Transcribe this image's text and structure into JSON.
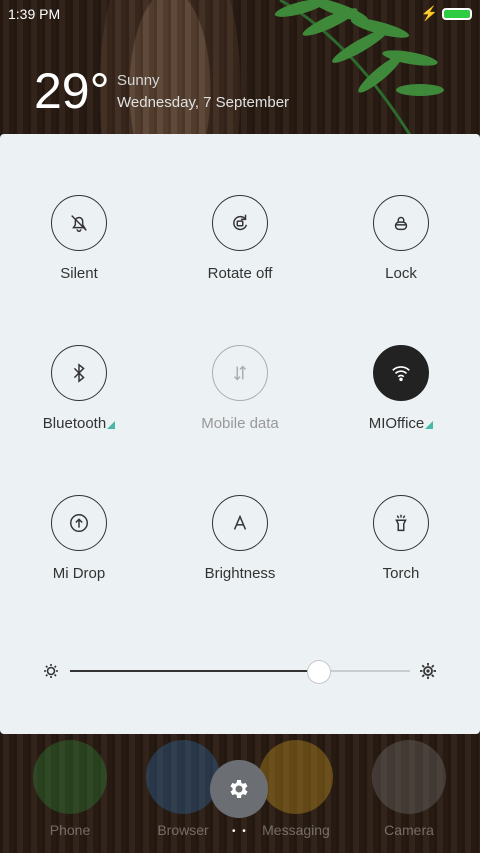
{
  "status_bar": {
    "time": "1:39 PM"
  },
  "weather": {
    "temperature": "29°",
    "condition": "Sunny",
    "date": "Wednesday, 7 September"
  },
  "quick_settings": [
    {
      "label": "Silent",
      "icon": "bell-off-icon",
      "state": "off"
    },
    {
      "label": "Rotate off",
      "icon": "rotate-lock-icon",
      "state": "off"
    },
    {
      "label": "Lock",
      "icon": "lock-icon",
      "state": "off"
    },
    {
      "label": "Bluetooth",
      "icon": "bluetooth-icon",
      "state": "off",
      "expandable": true
    },
    {
      "label": "Mobile data",
      "icon": "mobile-data-icon",
      "state": "disabled"
    },
    {
      "label": "MIOffice",
      "icon": "wifi-icon",
      "state": "on",
      "expandable": true
    },
    {
      "label": "Mi Drop",
      "icon": "upload-icon",
      "state": "off"
    },
    {
      "label": "Brightness",
      "icon": "auto-brightness-icon",
      "state": "off"
    },
    {
      "label": "Torch",
      "icon": "torch-icon",
      "state": "off"
    }
  ],
  "brightness": {
    "level": 0.73
  },
  "dock": [
    {
      "label": "Phone",
      "color": "#2e8b3a"
    },
    {
      "label": "Browser",
      "color": "#2f6fb0"
    },
    {
      "label": "Messaging",
      "color": "#d6a020"
    },
    {
      "label": "Camera",
      "color": "#777777"
    }
  ],
  "colors": {
    "accent": "#49b7a5",
    "active_tile": "#222222",
    "panel": "#ecf1f3"
  }
}
